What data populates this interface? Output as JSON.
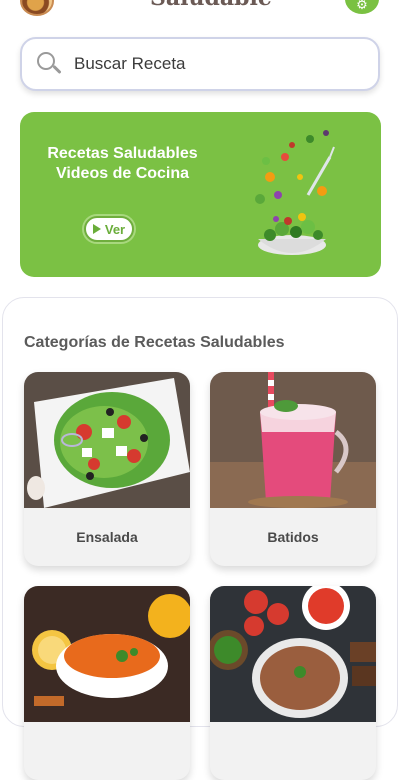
{
  "header": {
    "brand": "Saludable"
  },
  "search": {
    "placeholder": "Buscar Receta"
  },
  "banner": {
    "line1": "Recetas Saludables",
    "line2": "Videos de Cocina",
    "button_label": "Ver"
  },
  "categories": {
    "title": "Categorías de Recetas Saludables",
    "items": [
      {
        "label": "Ensalada"
      },
      {
        "label": "Batidos"
      },
      {
        "label": ""
      },
      {
        "label": ""
      }
    ]
  },
  "colors": {
    "accent": "#7bc144",
    "search_border": "#cfd3e8"
  },
  "icons": {
    "search": "search-icon",
    "settings": "gear-icon",
    "play": "play-icon"
  }
}
